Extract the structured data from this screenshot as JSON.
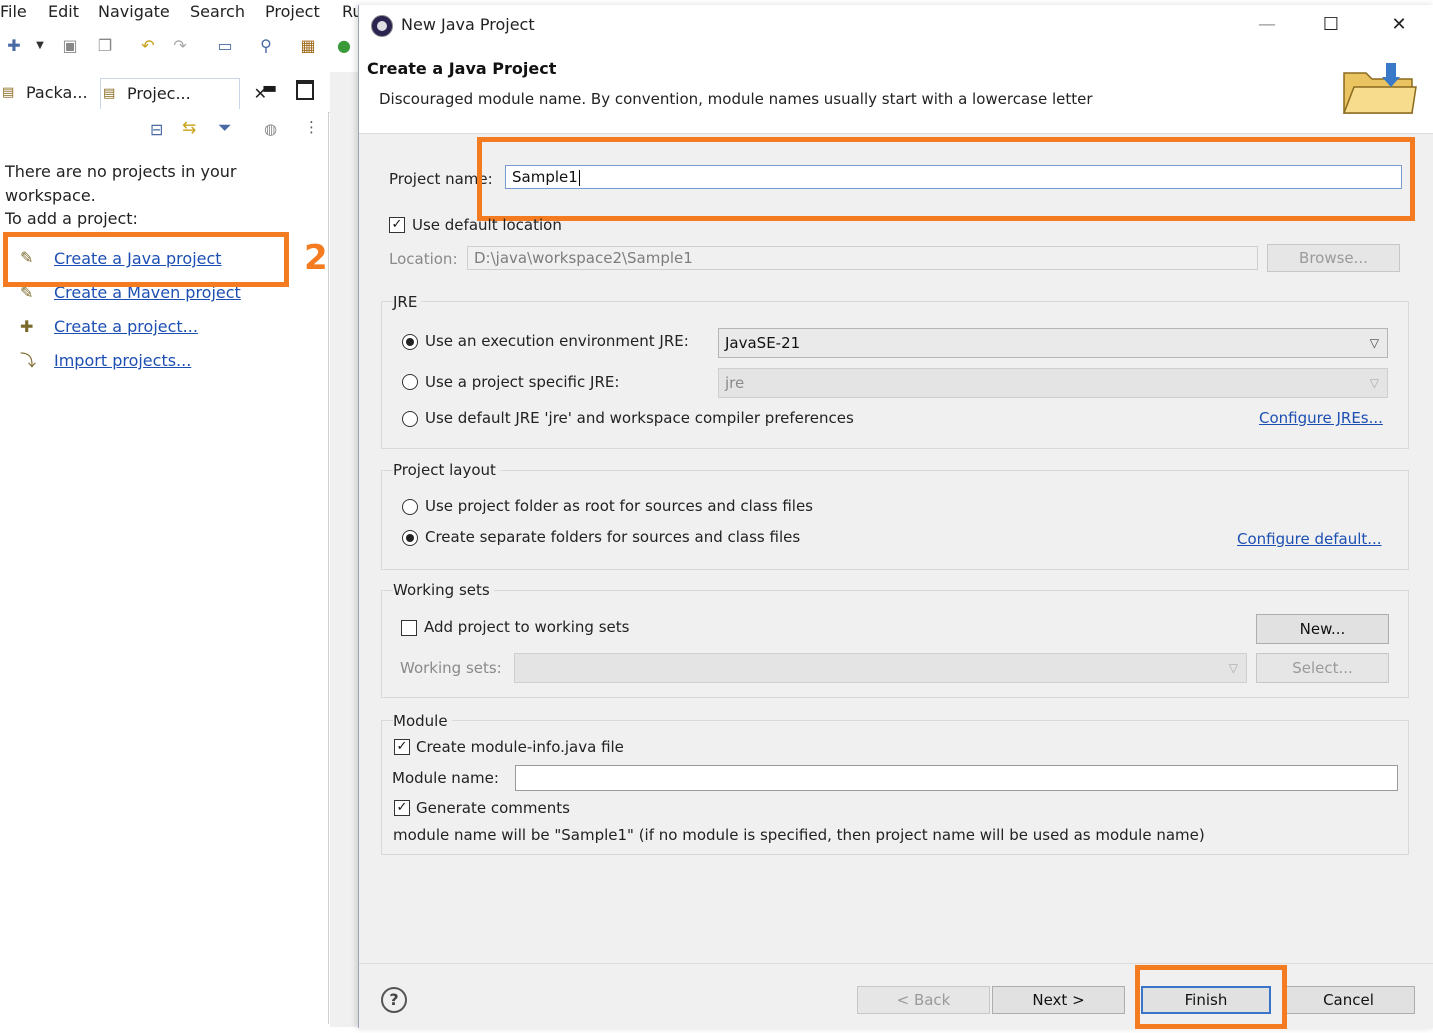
{
  "menubar": {
    "items": [
      "File",
      "Edit",
      "Navigate",
      "Search",
      "Project",
      "Ru"
    ]
  },
  "explorer": {
    "tabs": [
      "Packa...",
      "Projec..."
    ],
    "close_glyph": "✕",
    "message_line1": "There are no projects in your",
    "message_line2": "workspace.",
    "message_line3": "To add a project:",
    "links": [
      "Create a Java project",
      "Create a Maven project",
      "Create a project...",
      "Import projects..."
    ]
  },
  "annotation": {
    "step2": "2"
  },
  "dialog": {
    "title": "New Java Project",
    "heading": "Create a Java Project",
    "message": "Discouraged module name. By convention, module names usually start with a lowercase letter",
    "project_name_label": "Project name:",
    "project_name_value": "Sample1",
    "use_default_location_label": "Use default location",
    "location_label": "Location:",
    "location_value": "D:\\java\\workspace2\\Sample1",
    "browse_label": "Browse...",
    "jre": {
      "title": "JRE",
      "option_exec_env": "Use an execution environment JRE:",
      "exec_env_value": "JavaSE-21",
      "option_project_specific": "Use a project specific JRE:",
      "project_specific_value": "jre",
      "option_default": "Use default JRE 'jre' and workspace compiler preferences",
      "configure_link": "Configure JREs..."
    },
    "layout": {
      "title": "Project layout",
      "option_root": "Use project folder as root for sources and class files",
      "option_separate": "Create separate folders for sources and class files",
      "configure_link": "Configure default..."
    },
    "working_sets": {
      "title": "Working sets",
      "add_label": "Add project to working sets",
      "new_button": "New...",
      "sets_label": "Working sets:",
      "select_button": "Select..."
    },
    "module": {
      "title": "Module",
      "create_label": "Create module-info.java file",
      "name_label": "Module name:",
      "name_value": "",
      "comments_label": "Generate comments",
      "note": "module name will be \"Sample1\"  (if no module is specified, then project name will be used as module name)"
    },
    "buttons": {
      "back": "< Back",
      "next": "Next >",
      "finish": "Finish",
      "cancel": "Cancel"
    },
    "window": {
      "minimize": "—",
      "maximize": "☐",
      "close": "✕"
    }
  },
  "colors": {
    "highlight": "#f47b20",
    "link": "#1d4fb3",
    "dialog_bg": "#f0f0f0"
  },
  "icons": [
    "new-wizard-icon",
    "save-icon",
    "save-all-icon",
    "undo-icon",
    "redo-icon",
    "terminal-icon",
    "search-icon",
    "package-icon",
    "run-icon",
    "help-icon",
    "folder-icon"
  ]
}
